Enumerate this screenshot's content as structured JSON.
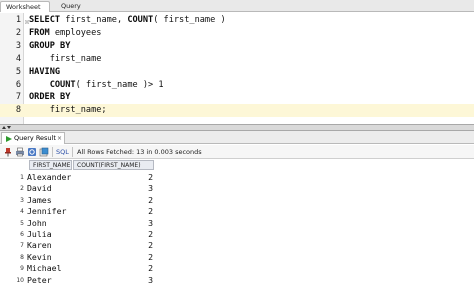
{
  "tabs": {
    "worksheet": "Worksheet",
    "query_builder": "Query Builder"
  },
  "editor": {
    "lines": [
      {
        "num": "1",
        "parts": [
          {
            "kw": "SELECT"
          },
          {
            "t": " first_name, "
          },
          {
            "kw": "COUNT"
          },
          {
            "t": "( first_name )"
          }
        ]
      },
      {
        "num": "2",
        "parts": [
          {
            "kw": "FROM"
          },
          {
            "t": " employees"
          }
        ]
      },
      {
        "num": "3",
        "parts": [
          {
            "kw": "GROUP BY"
          }
        ]
      },
      {
        "num": "4",
        "parts": [
          {
            "t": "    first_name"
          }
        ]
      },
      {
        "num": "5",
        "parts": [
          {
            "kw": "HAVING"
          }
        ]
      },
      {
        "num": "6",
        "parts": [
          {
            "t": "    "
          },
          {
            "kw": "COUNT"
          },
          {
            "t": "( first_name )> 1"
          }
        ]
      },
      {
        "num": "7",
        "parts": [
          {
            "kw": "ORDER BY"
          }
        ]
      },
      {
        "num": "8",
        "parts": [
          {
            "t": "    first_name;"
          }
        ]
      }
    ],
    "current_line": 8
  },
  "result_tab": {
    "label": "Query Result",
    "close": "×"
  },
  "toolbar": {
    "sql_label": "SQL",
    "status": "All Rows Fetched: 13 in 0.003 seconds"
  },
  "grid": {
    "columns": [
      "FIRST_NAME",
      "COUNT(FIRST_NAME)"
    ],
    "rows": [
      {
        "num": "1",
        "name": "Alexander",
        "count": "2"
      },
      {
        "num": "2",
        "name": "David",
        "count": "3"
      },
      {
        "num": "3",
        "name": "James",
        "count": "2"
      },
      {
        "num": "4",
        "name": "Jennifer",
        "count": "2"
      },
      {
        "num": "5",
        "name": "John",
        "count": "3"
      },
      {
        "num": "6",
        "name": "Julia",
        "count": "2"
      },
      {
        "num": "7",
        "name": "Karen",
        "count": "2"
      },
      {
        "num": "8",
        "name": "Kevin",
        "count": "2"
      },
      {
        "num": "9",
        "name": "Michael",
        "count": "2"
      },
      {
        "num": "10",
        "name": "Peter",
        "count": "3"
      }
    ]
  },
  "colors": {
    "current_line_bg": "#fdf7d7",
    "run_icon": "#2e9a2e",
    "pin_icon": "#c0392b"
  }
}
